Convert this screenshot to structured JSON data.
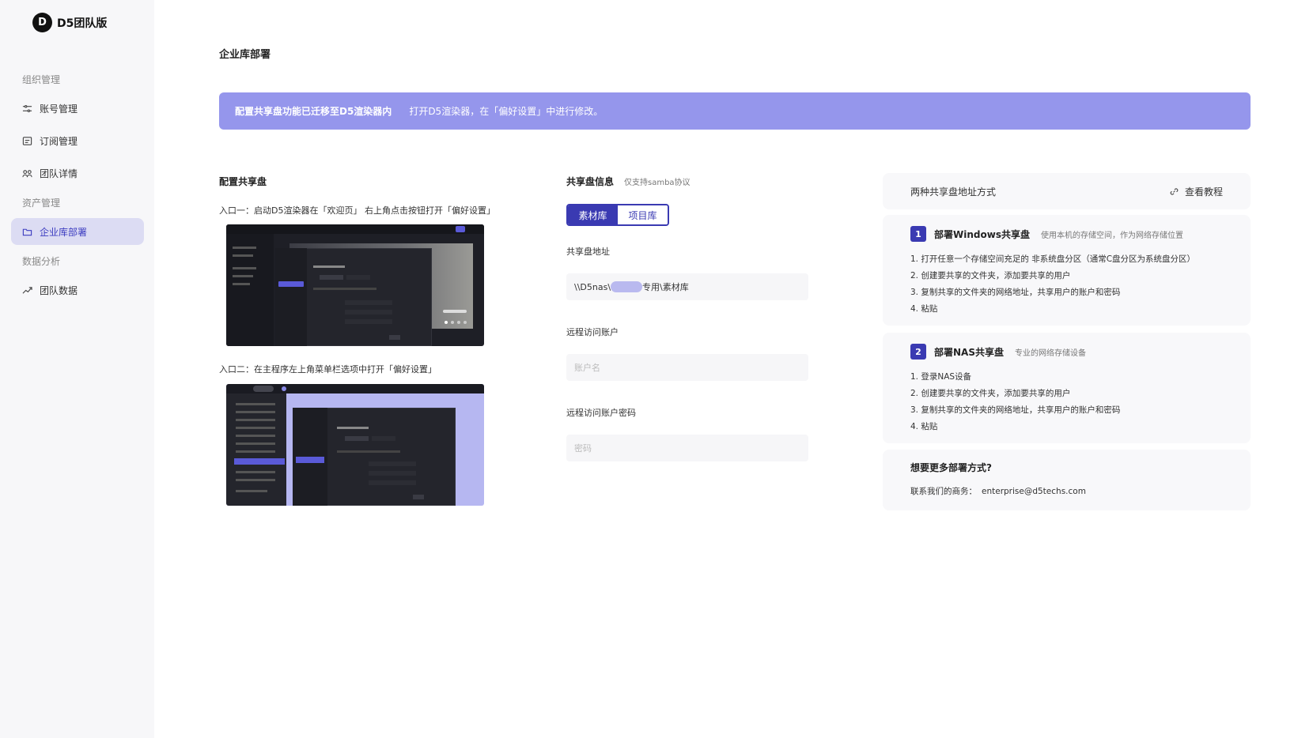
{
  "brand": {
    "logo": "D",
    "name": "D5团队版"
  },
  "sidebar": {
    "groups": [
      {
        "label": "组织管理"
      },
      {
        "label": "资产管理"
      },
      {
        "label": "数据分析"
      }
    ],
    "items": [
      {
        "label": "账号管理",
        "icon": "sliders-icon"
      },
      {
        "label": "订阅管理",
        "icon": "receipt-icon"
      },
      {
        "label": "团队详情",
        "icon": "team-icon"
      },
      {
        "label": "企业库部署",
        "icon": "folder-icon",
        "active": true
      },
      {
        "label": "团队数据",
        "icon": "trend-icon"
      }
    ]
  },
  "page": {
    "title": "企业库部署"
  },
  "banner": {
    "strong": "配置共享盘功能已迁移至D5渲染器内",
    "text": "打开D5渲染器，在「偏好设置」中进行修改。"
  },
  "config": {
    "title": "配置共享盘",
    "entry1": "入口一：启动D5渲染器在「欢迎页」 右上角点击按钮打开「偏好设置」",
    "entry2": "入口二：在主程序左上角菜单栏选项中打开「偏好设置」"
  },
  "share": {
    "title": "共享盘信息",
    "subtitle": "仅支持samba协议",
    "tabs": [
      "素材库",
      "项目库"
    ],
    "address_label": "共享盘地址",
    "address_prefix": "\\\\D5nas\\",
    "address_suffix": "专用\\素材库",
    "account_label": "远程访问账户",
    "account_placeholder": "账户名",
    "password_label": "远程访问账户密码",
    "password_placeholder": "密码"
  },
  "methods": {
    "title": "两种共享盘地址方式",
    "tutorial": "查看教程",
    "windows": {
      "num": "1",
      "title": "部署Windows共享盘",
      "sub": "使用本机的存储空间，作为网络存储位置",
      "steps": [
        "1. 打开任意一个存储空间充足的 非系统盘分区（通常C盘分区为系统盘分区）",
        "2. 创建要共享的文件夹，添加要共享的用户",
        "3. 复制共享的文件夹的网络地址，共享用户的账户和密码",
        "4. 粘贴"
      ]
    },
    "nas": {
      "num": "2",
      "title": "部署NAS共享盘",
      "sub": "专业的网络存储设备",
      "steps": [
        "1. 登录NAS设备",
        "2. 创建要共享的文件夹，添加要共享的用户",
        "3. 复制共享的文件夹的网络地址，共享用户的账户和密码",
        "4. 粘贴"
      ]
    }
  },
  "more": {
    "title": "想要更多部署方式?",
    "contact_label": "联系我们的商务：",
    "email": "enterprise@d5techs.com"
  },
  "colors": {
    "accent": "#3a3ab2",
    "banner": "#9596ec",
    "active_nav": "#dcdcf3"
  }
}
